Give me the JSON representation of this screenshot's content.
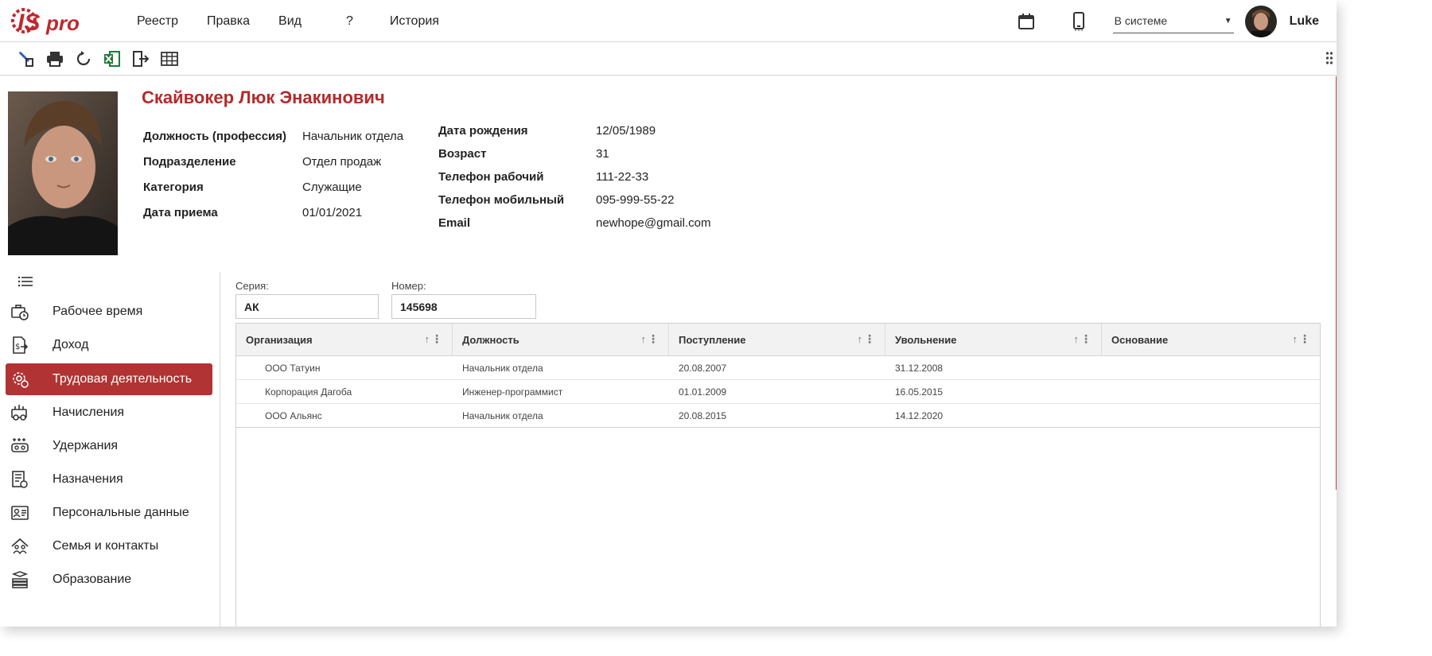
{
  "menu": {
    "items": [
      "Реестр",
      "Правка",
      "Вид",
      "?",
      "История"
    ]
  },
  "topbar": {
    "status_value": "В системе",
    "user_name": "Luke"
  },
  "employee": {
    "name": "Скайвокер Люк Энакинович",
    "left_info": [
      {
        "label": "Должность (профессия)",
        "value": "Начальник отдела"
      },
      {
        "label": "Подразделение",
        "value": "Отдел продаж"
      },
      {
        "label": "Категория",
        "value": "Служащие"
      },
      {
        "label": "Дата приема",
        "value": "01/01/2021"
      }
    ],
    "right_info": [
      {
        "label": "Дата рождения",
        "value": "12/05/1989"
      },
      {
        "label": "Возраст",
        "value": "31"
      },
      {
        "label": "Телефон рабочий",
        "value": "111-22-33"
      },
      {
        "label": "Телефон мобильный",
        "value": "095-999-55-22"
      },
      {
        "label": "Email",
        "value": "newhope@gmail.com"
      }
    ]
  },
  "sidebar": {
    "items": [
      {
        "label": "Рабочее время",
        "icon": "clock-briefcase-icon",
        "active": false
      },
      {
        "label": "Доход",
        "icon": "income-document-icon",
        "active": false
      },
      {
        "label": "Трудовая деятельность",
        "icon": "gear-person-icon",
        "active": true
      },
      {
        "label": "Начисления",
        "icon": "accruals-icon",
        "active": false
      },
      {
        "label": "Удержания",
        "icon": "deductions-icon",
        "active": false
      },
      {
        "label": "Назначения",
        "icon": "assignments-icon",
        "active": false
      },
      {
        "label": "Персональные данные",
        "icon": "personal-data-icon",
        "active": false
      },
      {
        "label": "Семья и контакты",
        "icon": "family-contacts-icon",
        "active": false
      },
      {
        "label": "Образование",
        "icon": "education-books-icon",
        "active": false
      }
    ]
  },
  "work_book": {
    "series_label": "Серия:",
    "series_value": "АК",
    "number_label": "Номер:",
    "number_value": "145698"
  },
  "grid": {
    "columns": [
      "Организация",
      "Должность",
      "Поступление",
      "Увольнение",
      "Основание"
    ],
    "rows": [
      [
        "ООО Татуин",
        "Начальник отдела",
        "20.08.2007",
        "31.12.2008",
        ""
      ],
      [
        "Корпорация Дагоба",
        "Инженер-программист",
        "01.01.2009",
        "16.05.2015",
        ""
      ],
      [
        "ООО Альянс",
        "Начальник отдела",
        "20.08.2015",
        "14.12.2020",
        ""
      ]
    ]
  },
  "colors": {
    "accent": "#b23333",
    "name_red": "#b52a2a",
    "excel_green": "#1f7a3a"
  }
}
